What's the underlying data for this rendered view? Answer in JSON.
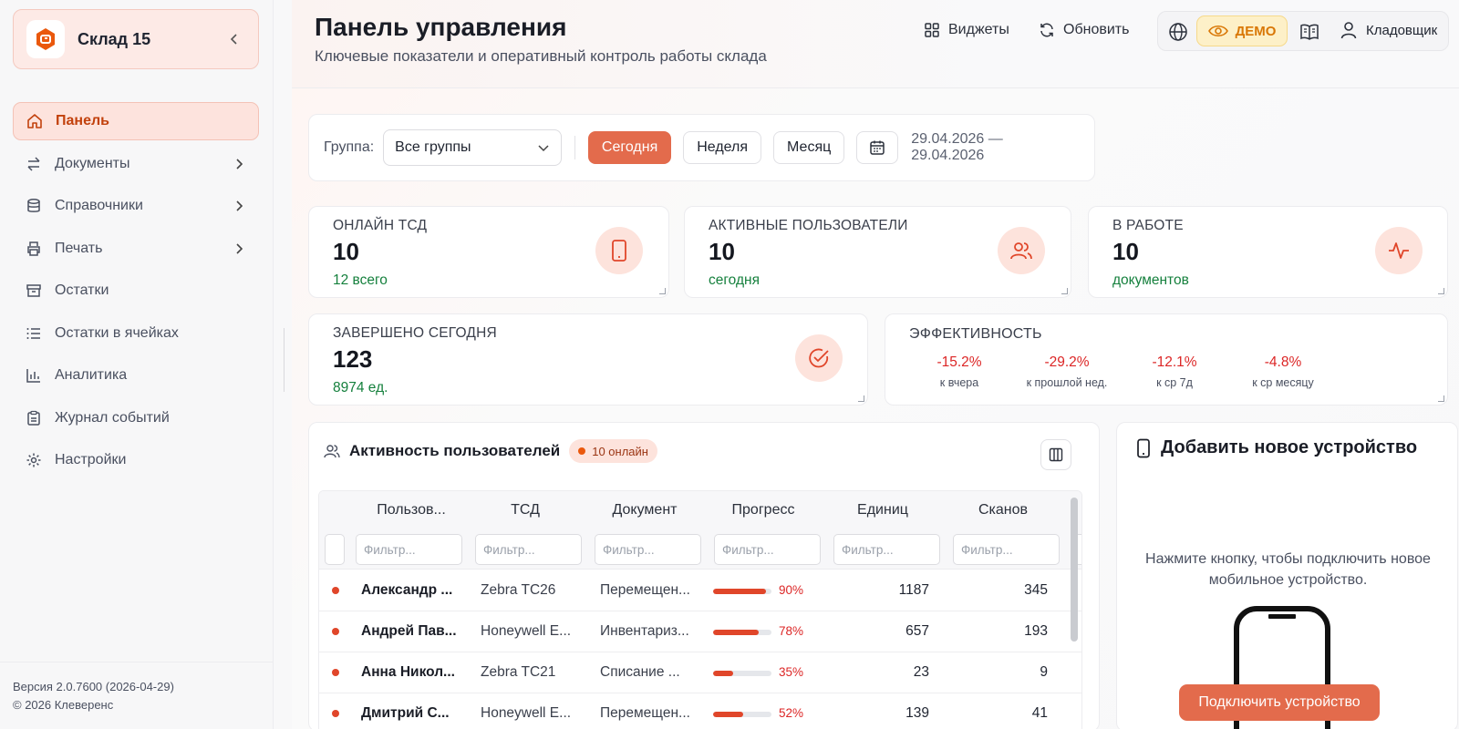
{
  "brand": {
    "name": "Склад 15"
  },
  "nav": [
    {
      "label": "Панель",
      "icon": "home-icon",
      "active": true,
      "has_children": false
    },
    {
      "label": "Документы",
      "icon": "swap-icon",
      "has_children": true
    },
    {
      "label": "Справочники",
      "icon": "database-icon",
      "has_children": true
    },
    {
      "label": "Печать",
      "icon": "printer-icon",
      "has_children": true
    },
    {
      "label": "Остатки",
      "icon": "archive-icon",
      "has_children": false
    },
    {
      "label": "Остатки в ячейках",
      "icon": "list-icon",
      "has_children": false
    },
    {
      "label": "Аналитика",
      "icon": "bar-chart-icon",
      "has_children": false
    },
    {
      "label": "Журнал событий",
      "icon": "clipboard-icon",
      "has_children": false
    },
    {
      "label": "Настройки",
      "icon": "gear-icon",
      "has_children": false
    }
  ],
  "footer": {
    "version": "Версия 2.0.7600 (2026-04-29)",
    "copyright": "© 2026 Клеверенс"
  },
  "header": {
    "title": "Панель управления",
    "subtitle": "Ключевые показатели и оперативный контроль работы склада",
    "widgets_label": "Виджеты",
    "refresh_label": "Обновить",
    "demo_label": "ДЕМО",
    "user_label": "Кладовщик"
  },
  "filters": {
    "group_label": "Группа:",
    "group_value": "Все группы",
    "periods": [
      "Сегодня",
      "Неделя",
      "Месяц"
    ],
    "active_period": "Сегодня",
    "date_range": "29.04.2026 — 29.04.2026"
  },
  "stats": {
    "online_tsd": {
      "label": "ОНЛАЙН ТСД",
      "value": "10",
      "sub": "12 всего",
      "icon": "tablet-icon"
    },
    "active_users": {
      "label": "АКТИВНЫЕ ПОЛЬЗОВАТЕЛИ",
      "value": "10",
      "sub": "сегодня",
      "icon": "users-icon"
    },
    "in_work": {
      "label": "В РАБОТЕ",
      "value": "10",
      "sub": "документов",
      "icon": "activity-icon"
    },
    "completed": {
      "label": "ЗАВЕРШЕНО СЕГОДНЯ",
      "value": "123",
      "sub": "8974 ед.",
      "icon": "check-circle-icon"
    }
  },
  "efficiency": {
    "title": "ЭФФЕКТИВНОСТЬ",
    "items": [
      {
        "value": "-15.2%",
        "caption": "к вчера"
      },
      {
        "value": "-29.2%",
        "caption": "к прошлой нед."
      },
      {
        "value": "-12.1%",
        "caption": "к ср 7д"
      },
      {
        "value": "-4.8%",
        "caption": "к ср месяцу"
      }
    ]
  },
  "activity": {
    "title": "Активность пользователей",
    "online_badge": "10 онлайн",
    "columns": [
      "Пользов...",
      "ТСД",
      "Документ",
      "Прогресс",
      "Единиц",
      "Сканов"
    ],
    "filter_placeholder": "Фильтр...",
    "rows": [
      {
        "user": "Александр ...",
        "tsd": "Zebra TC26",
        "doc": "Перемещен...",
        "progress": 90,
        "progress_label": "90%",
        "units": "1187",
        "scans": "345"
      },
      {
        "user": "Андрей Пав...",
        "tsd": "Honeywell E...",
        "doc": "Инвентариз...",
        "progress": 78,
        "progress_label": "78%",
        "units": "657",
        "scans": "193"
      },
      {
        "user": "Анна Никол...",
        "tsd": "Zebra TC21",
        "doc": "Списание ...",
        "progress": 35,
        "progress_label": "35%",
        "units": "23",
        "scans": "9"
      },
      {
        "user": "Дмитрий С...",
        "tsd": "Honeywell E...",
        "doc": "Перемещен...",
        "progress": 52,
        "progress_label": "52%",
        "units": "139",
        "scans": "41"
      }
    ]
  },
  "device": {
    "title": "Добавить новое устройство",
    "text_line1": "Нажмите кнопку, чтобы подключить новое",
    "text_line2": "мобильное устройство.",
    "button_label": "Подключить устройство"
  },
  "colors": {
    "accent": "#e36b4c",
    "success": "#15803d",
    "danger": "#dc2626",
    "demo": "#d97706"
  }
}
